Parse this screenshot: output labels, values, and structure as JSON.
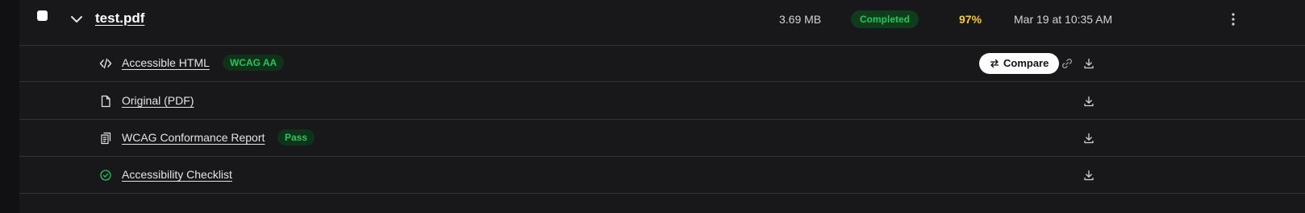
{
  "file": {
    "name": "test.pdf",
    "size": "3.69 MB",
    "status": "Completed",
    "score": "97%",
    "date": "Mar 19 at 10:35 AM",
    "selected": false,
    "expanded": true
  },
  "outputs": [
    {
      "label": "Accessible HTML",
      "icon": "code-icon",
      "badge": "WCAG AA",
      "compare_label": "Compare"
    },
    {
      "label": "Original (PDF)",
      "icon": "file-icon",
      "badge": ""
    },
    {
      "label": "WCAG Conformance Report",
      "icon": "report-icon",
      "badge": "Pass"
    },
    {
      "label": "Accessibility Checklist",
      "icon": "check-circle-icon",
      "badge": ""
    }
  ],
  "colors": {
    "background": "#111113",
    "panel": "#18181b",
    "success": "#22c55e",
    "score": "#facc15"
  }
}
